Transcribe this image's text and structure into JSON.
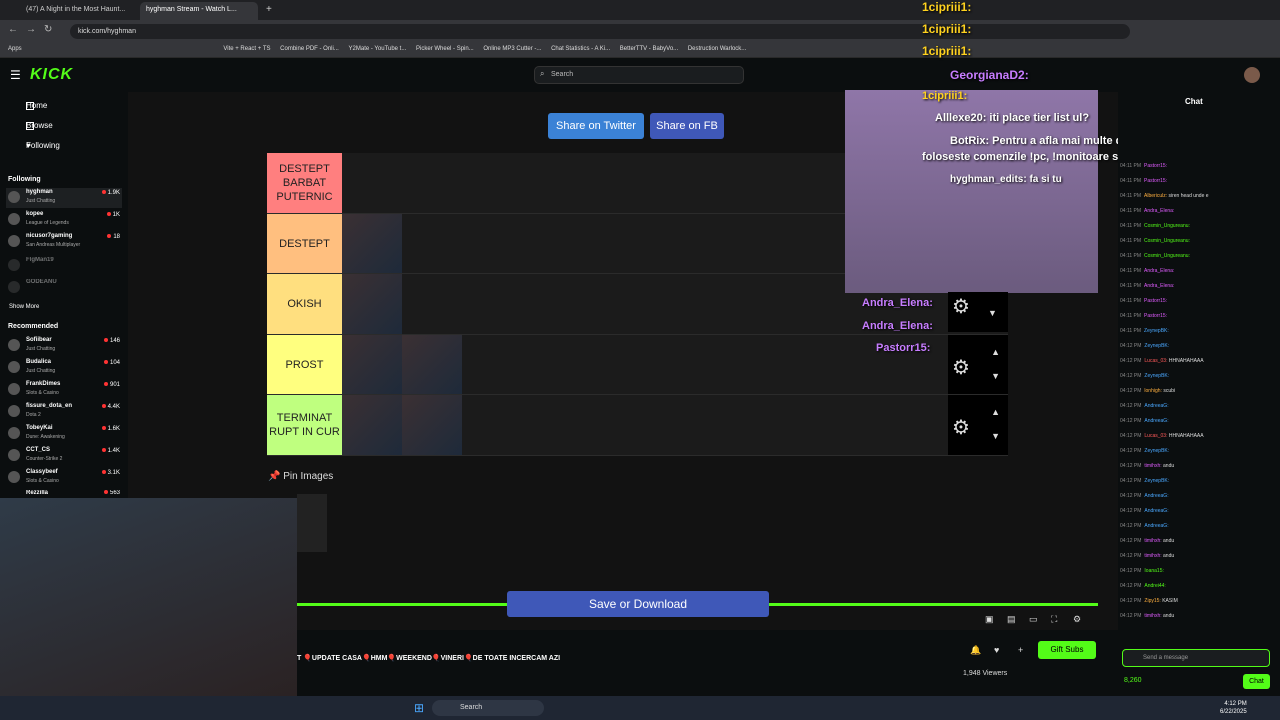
{
  "browser": {
    "tabs": [
      {
        "label": "(47) A Night in the Most Haunt...",
        "close": "×"
      },
      {
        "label": "hyghman Stream - Watch L...",
        "close": "×"
      }
    ],
    "new_tab": "+",
    "url": "kick.com/hyghman",
    "bookmarks": [
      "Apps",
      "Vite + React + TS",
      "Combine PDF - Onli...",
      "Y2Mate - YouTube t...",
      "Picker Wheel - Spin...",
      "Online MP3 Cutter -...",
      "Chat Statistics - A Ki...",
      "BetterTTV - BabyVo...",
      "Destruction Warlock..."
    ]
  },
  "header": {
    "logo": "KICK",
    "search_placeholder": "Search"
  },
  "sidebar": {
    "nav": [
      {
        "label": "Home"
      },
      {
        "label": "Browse"
      },
      {
        "label": "Following"
      }
    ],
    "following_title": "Following",
    "following": [
      {
        "name": "hyghman",
        "game": "Just Chatting",
        "viewers": "1.9K"
      },
      {
        "name": "kopee",
        "game": "League of Legends",
        "viewers": "1K"
      },
      {
        "name": "nicusor7gaming",
        "game": "San Andreas Multiplayer",
        "viewers": "18"
      },
      {
        "name": "FlgMan19",
        "game": "",
        "viewers": ""
      },
      {
        "name": "GODEANU",
        "game": "",
        "viewers": ""
      }
    ],
    "show_more": "Show More",
    "recommended_title": "Recommended",
    "recommended": [
      {
        "name": "Sofiibear",
        "game": "Just Chatting",
        "viewers": "146"
      },
      {
        "name": "Budalica",
        "game": "Just Chatting",
        "viewers": "104"
      },
      {
        "name": "FrankDimes",
        "game": "Slots & Casino",
        "viewers": "901"
      },
      {
        "name": "fissure_dota_en",
        "game": "Dota 2",
        "viewers": "4.4K"
      },
      {
        "name": "TobeyKai",
        "game": "Dune: Awakening",
        "viewers": "1.6K"
      },
      {
        "name": "CCT_CS",
        "game": "Counter-Strike 2",
        "viewers": "1.4K"
      },
      {
        "name": "Classybeef",
        "game": "Slots & Casino",
        "viewers": "3.1K"
      },
      {
        "name": "Rezzilla",
        "game": "",
        "viewers": "563"
      }
    ]
  },
  "tierlist": {
    "share_twitter": "Share on Twitter",
    "share_fb": "Share on FB",
    "tiers": [
      {
        "label": "DESTEPT BARBAT PUTERNIC",
        "color": "#ff7f7f",
        "images": 0
      },
      {
        "label": "DESTEPT",
        "color": "#ffbf7f",
        "images": 1
      },
      {
        "label": "OKISH",
        "color": "#ffdf7f",
        "images": 1
      },
      {
        "label": "PROST",
        "color": "#ffff7f",
        "images": 2
      },
      {
        "label": "TERMINAT RUPT IN CUR",
        "color": "#bfff7f",
        "images": 2
      }
    ],
    "pin_images": "Pin Images",
    "save": "Save or Download"
  },
  "overlay": {
    "top_lines": [
      "1cipriii1:",
      "1cipriii1:",
      "1cipriii1:"
    ],
    "georgiana": "GeorgianaD2:",
    "line1": "1cipriii1:",
    "line2": "Alllexe20: iti place tier list ul?",
    "line3a": "BotRix: Pentru a afla mai multe despre setup-ul meu",
    "line3b": "foloseste comenzile !pc, !monitoare si !periferice",
    "line4": "hyghman_edits: fa si tu",
    "line5": "Andra_Elena:",
    "line6": "Andra_Elena:",
    "line7": "Pastorr15:"
  },
  "player": {
    "ticker": "T 🎈UPDATE CASA🎈HMM🎈WEEKEND🎈VINERI🎈DE TOATE INCERCAM AZI",
    "gift_subs": "Gift Subs",
    "viewers": "1,948 Viewers"
  },
  "chat": {
    "title": "Chat",
    "messages": [
      {
        "time": "04:11 PM",
        "user": "Pastorr15:",
        "text": "",
        "color": "#e05dff"
      },
      {
        "time": "04:11 PM",
        "user": "Pastorr15:",
        "text": "",
        "color": "#e05dff"
      },
      {
        "time": "04:11 PM",
        "user": "Albericulz:",
        "text": "siren head unde e",
        "color": "#ffb040"
      },
      {
        "time": "04:11 PM",
        "user": "Andra_Elena:",
        "text": "",
        "color": "#e05dff"
      },
      {
        "time": "04:11 PM",
        "user": "Cosmin_Ungureanu:",
        "text": "",
        "color": "#53fc18"
      },
      {
        "time": "04:11 PM",
        "user": "Cosmin_Ungureanu:",
        "text": "",
        "color": "#53fc18"
      },
      {
        "time": "04:11 PM",
        "user": "Cosmin_Ungureanu:",
        "text": "",
        "color": "#53fc18"
      },
      {
        "time": "04:11 PM",
        "user": "Andra_Elena:",
        "text": "",
        "color": "#e05dff"
      },
      {
        "time": "04:11 PM",
        "user": "Andra_Elena:",
        "text": "",
        "color": "#e05dff"
      },
      {
        "time": "04:11 PM",
        "user": "Pastorr15:",
        "text": "",
        "color": "#e05dff"
      },
      {
        "time": "04:11 PM",
        "user": "Pastorr15:",
        "text": "",
        "color": "#e05dff"
      },
      {
        "time": "04:11 PM",
        "user": "ZeynepBK:",
        "text": "",
        "color": "#4aa8ff"
      },
      {
        "time": "04:12 PM",
        "user": "ZeynepBK:",
        "text": "",
        "color": "#4aa8ff"
      },
      {
        "time": "04:12 PM",
        "user": "Lucas_03:",
        "text": "HHNAHAHAAA",
        "color": "#ff5a5a"
      },
      {
        "time": "04:12 PM",
        "user": "ZeynepBK:",
        "text": "",
        "color": "#4aa8ff"
      },
      {
        "time": "04:12 PM",
        "user": "lonhigh:",
        "text": "scubi",
        "color": "#ffb040"
      },
      {
        "time": "04:12 PM",
        "user": "AndreeaG:",
        "text": "",
        "color": "#4aa8ff"
      },
      {
        "time": "04:12 PM",
        "user": "AndreeaG:",
        "text": "",
        "color": "#4aa8ff"
      },
      {
        "time": "04:12 PM",
        "user": "Lucas_03:",
        "text": "HHNAHAHAAA",
        "color": "#ff5a5a"
      },
      {
        "time": "04:12 PM",
        "user": "ZeynepBK:",
        "text": "",
        "color": "#4aa8ff"
      },
      {
        "time": "04:12 PM",
        "user": "timihxh:",
        "text": "andu",
        "color": "#e05dff"
      },
      {
        "time": "04:12 PM",
        "user": "ZeynepBK:",
        "text": "",
        "color": "#4aa8ff"
      },
      {
        "time": "04:12 PM",
        "user": "AndreeaG:",
        "text": "",
        "color": "#4aa8ff"
      },
      {
        "time": "04:12 PM",
        "user": "AndreeaG:",
        "text": "",
        "color": "#4aa8ff"
      },
      {
        "time": "04:12 PM",
        "user": "AndreeaG:",
        "text": "",
        "color": "#4aa8ff"
      },
      {
        "time": "04:12 PM",
        "user": "timihxh:",
        "text": "andu",
        "color": "#e05dff"
      },
      {
        "time": "04:12 PM",
        "user": "timihxh:",
        "text": "andu",
        "color": "#e05dff"
      },
      {
        "time": "04:12 PM",
        "user": "Ioana15:",
        "text": "",
        "color": "#53fc18"
      },
      {
        "time": "04:12 PM",
        "user": "Andrei44:",
        "text": "",
        "color": "#53fc18"
      },
      {
        "time": "04:12 PM",
        "user": "Zipy15:",
        "text": "KASIM",
        "color": "#ffb040"
      },
      {
        "time": "04:12 PM",
        "user": "timihxh:",
        "text": "andu",
        "color": "#e05dff"
      }
    ],
    "input_placeholder": "Send a message",
    "points": "8,260",
    "send": "Chat"
  },
  "taskbar": {
    "search": "Search",
    "time": "4:12 PM",
    "date": "6/22/2025"
  },
  "colors": {
    "accent": "#53fc18",
    "twitter": "#3b82d6",
    "facebook": "#3f58b8"
  }
}
